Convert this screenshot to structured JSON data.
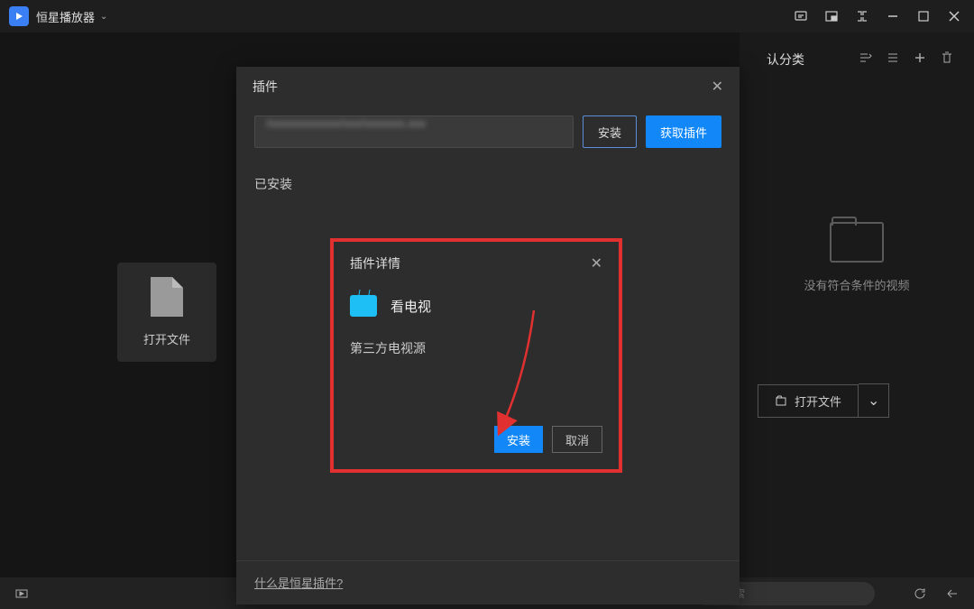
{
  "app": {
    "title": "恒星播放器"
  },
  "leftTile": {
    "label": "打开文件"
  },
  "rightPanel": {
    "category": "认分类",
    "emptyText": "没有符合条件的视频",
    "openBtn": "打开文件"
  },
  "pluginModal": {
    "title": "插件",
    "pathBlurred": "/xxxxxxxxxxxx/xxx/xxxxxxx.xxx",
    "installBtn": "安装",
    "getPluginBtn": "获取插件",
    "installedLabel": "已安装",
    "footerLink": "什么是恒星插件?"
  },
  "detailBox": {
    "title": "插件详情",
    "pluginName": "看电视",
    "pluginDesc": "第三方电视源",
    "installBtn": "安装",
    "cancelBtn": "取消"
  },
  "search": {
    "placeholder": "搜索"
  }
}
